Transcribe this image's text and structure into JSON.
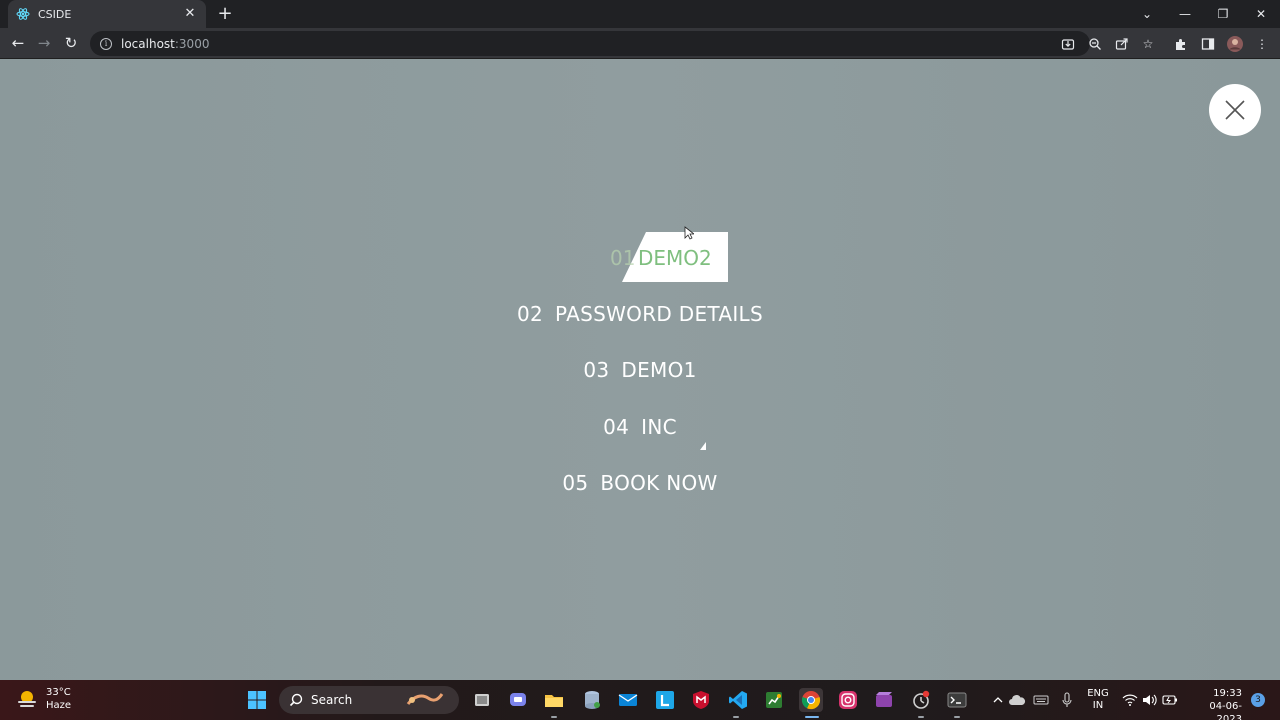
{
  "browser": {
    "tab_title": "CSIDE",
    "url_host": "localhost",
    "url_port": ":3000"
  },
  "menu": {
    "items": [
      {
        "num": "01",
        "label": "DEMO2",
        "active": true
      },
      {
        "num": "02",
        "label": "PASSWORD DETAILS",
        "active": false
      },
      {
        "num": "03",
        "label": "DEMO1",
        "active": false
      },
      {
        "num": "04",
        "label": "INC",
        "active": false
      },
      {
        "num": "05",
        "label": "BOOK NOW",
        "active": false
      }
    ]
  },
  "colors": {
    "overlay": "#8c9a9c",
    "active_text": "#7fbf7f",
    "menu_text": "#ffffff"
  },
  "taskbar": {
    "weather_temp": "33°C",
    "weather_desc": "Haze",
    "search_label": "Search",
    "lang_line1": "ENG",
    "lang_line2": "IN",
    "time": "19:33",
    "date": "04-06-2023",
    "notification_count": "3"
  },
  "icons": {
    "tab": "react-icon",
    "close": "close-icon",
    "info": "info-icon"
  }
}
